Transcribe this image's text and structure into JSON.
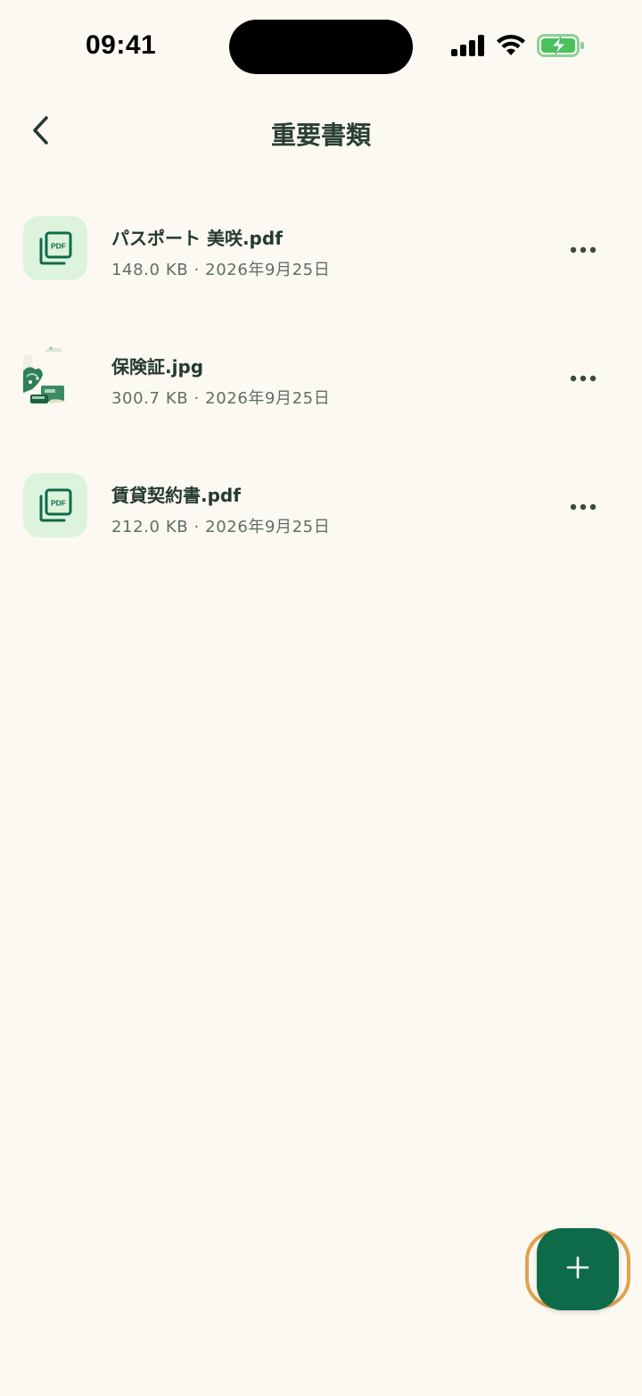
{
  "status_bar": {
    "time": "09:41",
    "icons": [
      "cellular-signal-icon",
      "wifi-icon",
      "battery-charging-icon"
    ]
  },
  "header": {
    "back_icon": "chevron-left-icon",
    "title": "重要書類"
  },
  "files": [
    {
      "name": "パスポート 美咲.pdf",
      "meta": "148.0 KB · 2026年9月25日",
      "type": "pdf",
      "icon": "pdf-file-icon",
      "menu_icon": "more-horizontal-icon"
    },
    {
      "name": "保険証.jpg",
      "meta": "300.7 KB · 2026年9月25日",
      "type": "image",
      "icon": "image-thumbnail",
      "menu_icon": "more-horizontal-icon"
    },
    {
      "name": "賃貸契約書.pdf",
      "meta": "212.0 KB · 2026年9月25日",
      "type": "pdf",
      "icon": "pdf-file-icon",
      "menu_icon": "more-horizontal-icon"
    }
  ],
  "fab": {
    "icon": "plus-icon"
  },
  "colors": {
    "background": "#FBF9F2",
    "accent": "#0E6B4A",
    "fab_ring": "#E0A24C",
    "thumb_bg": "#DDF3DC",
    "battery": "#49C25B"
  }
}
